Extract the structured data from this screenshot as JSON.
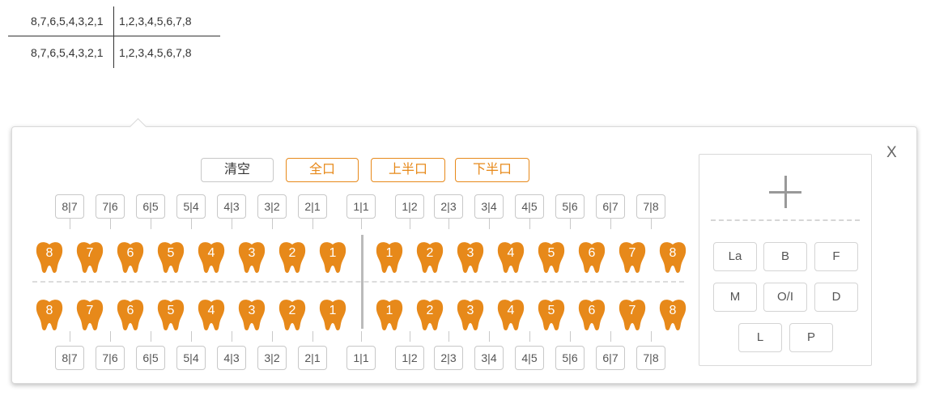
{
  "formula": {
    "upper_left": "8,7,6,5,4,3,2,1",
    "upper_right": "1,2,3,4,5,6,7,8",
    "lower_left": "8,7,6,5,4,3,2,1",
    "lower_right": "1,2,3,4,5,6,7,8"
  },
  "panel": {
    "close_label": "X",
    "buttons": {
      "clear": "清空",
      "full": "全口",
      "upper": "上半口",
      "lower": "下半口"
    },
    "accent_color": "#e7891a",
    "upper_tags": [
      "8|7",
      "7|6",
      "6|5",
      "5|4",
      "4|3",
      "3|2",
      "2|1",
      "1|1",
      "1|2",
      "2|3",
      "3|4",
      "4|5",
      "5|6",
      "6|7",
      "7|8"
    ],
    "lower_tags": [
      "8|7",
      "7|6",
      "6|5",
      "5|4",
      "4|3",
      "3|2",
      "2|1",
      "1|1",
      "1|2",
      "2|3",
      "3|4",
      "4|5",
      "5|6",
      "6|7",
      "7|8"
    ],
    "upper_teeth": [
      "8",
      "7",
      "6",
      "5",
      "4",
      "3",
      "2",
      "1",
      "1",
      "2",
      "3",
      "4",
      "5",
      "6",
      "7",
      "8"
    ],
    "lower_teeth": [
      "8",
      "7",
      "6",
      "5",
      "4",
      "3",
      "2",
      "1",
      "1",
      "2",
      "3",
      "4",
      "5",
      "6",
      "7",
      "8"
    ],
    "surfaces": {
      "add_icon": "plus-icon",
      "items": [
        "La",
        "B",
        "F",
        "M",
        "O/I",
        "D",
        "L",
        "P"
      ]
    }
  }
}
